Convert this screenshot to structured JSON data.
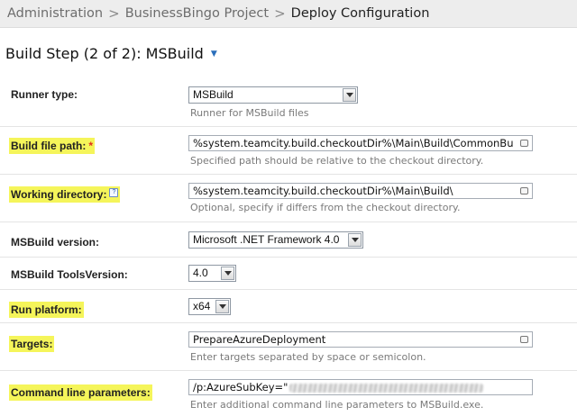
{
  "breadcrumb": {
    "items": [
      "Administration",
      "BusinessBingo Project"
    ],
    "separator": ">",
    "current": "Deploy Configuration"
  },
  "page": {
    "title": "Build Step (2 of 2): MSBuild"
  },
  "form": {
    "runner_type": {
      "label": "Runner type:",
      "value": "MSBuild",
      "hint": "Runner for MSBuild files"
    },
    "build_file_path": {
      "label": "Build file path:",
      "required_mark": "*",
      "value": "%system.teamcity.build.checkoutDir%\\Main\\Build\\CommonBu",
      "hint": "Specified path should be relative to the checkout directory."
    },
    "working_directory": {
      "label": "Working directory:",
      "help": "?",
      "value": "%system.teamcity.build.checkoutDir%\\Main\\Build\\",
      "hint": "Optional, specify if differs from the checkout directory."
    },
    "msbuild_version": {
      "label": "MSBuild version:",
      "value": "Microsoft .NET Framework 4.0"
    },
    "msbuild_tools_version": {
      "label": "MSBuild ToolsVersion:",
      "value": "4.0"
    },
    "run_platform": {
      "label": "Run platform:",
      "value": "x64"
    },
    "targets": {
      "label": "Targets:",
      "value": "PrepareAzureDeployment",
      "hint": "Enter targets separated by space or semicolon."
    },
    "command_line_parameters": {
      "label": "Command line parameters:",
      "value": "/p:AzureSubKey=\"",
      "hint": "Enter additional command line parameters to MSBuild.exe."
    }
  },
  "colors": {
    "highlight": "#f5f55a",
    "required": "#e0301e",
    "accent": "#2a6ebb"
  }
}
